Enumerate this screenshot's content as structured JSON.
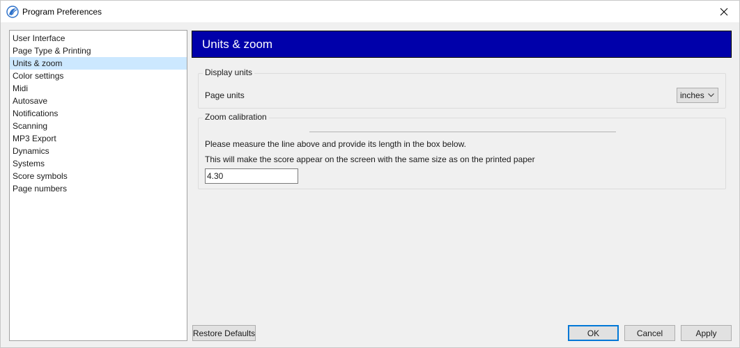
{
  "window": {
    "title": "Program Preferences"
  },
  "sidebar": {
    "items": [
      {
        "label": "User Interface"
      },
      {
        "label": "Page Type & Printing"
      },
      {
        "label": "Units & zoom",
        "selected": true
      },
      {
        "label": "Color settings"
      },
      {
        "label": "Midi"
      },
      {
        "label": "Autosave"
      },
      {
        "label": "Notifications"
      },
      {
        "label": "Scanning"
      },
      {
        "label": "MP3 Export"
      },
      {
        "label": "Dynamics"
      },
      {
        "label": "Systems"
      },
      {
        "label": "Score symbols"
      },
      {
        "label": "Page numbers"
      }
    ]
  },
  "panel": {
    "header": "Units & zoom",
    "header_color": "#0000aa",
    "display_units": {
      "title": "Display units",
      "page_units_label": "Page units",
      "page_units_value": "inches"
    },
    "zoom_calibration": {
      "title": "Zoom calibration",
      "instruction_1": "Please measure the line above and provide its length in the box below.",
      "instruction_2": "This will make the score appear on the screen with the same size as on the printed paper",
      "value": "4.30"
    }
  },
  "buttons": {
    "restore_defaults": "Restore Defaults",
    "ok": "OK",
    "cancel": "Cancel",
    "apply": "Apply"
  },
  "colors": {
    "selection": "#cce8ff",
    "focus_border": "#0078d7"
  }
}
